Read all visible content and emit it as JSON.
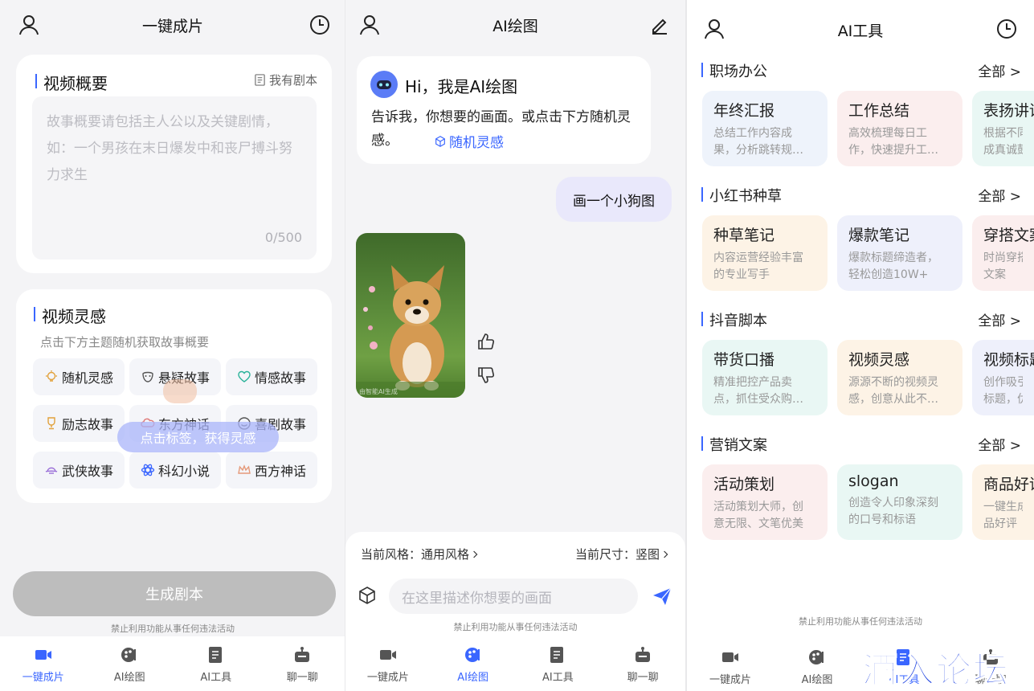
{
  "panel1": {
    "title": "一键成片",
    "summary": {
      "heading": "视频概要",
      "my_script": "我有剧本",
      "placeholder": "故事概要请包括主人公以及关键剧情，如：一个男孩在末日爆发中和丧尸搏斗努力求生",
      "counter": "0/500"
    },
    "inspiration": {
      "heading": "视频灵感",
      "hint": "点击下方主题随机获取故事概要",
      "tags": [
        {
          "label": "随机灵感",
          "icon": "bulb-icon"
        },
        {
          "label": "悬疑故事",
          "icon": "mask-icon"
        },
        {
          "label": "情感故事",
          "icon": "heart-icon"
        },
        {
          "label": "励志故事",
          "icon": "trophy-icon"
        },
        {
          "label": "东方神话",
          "icon": "cloud-icon"
        },
        {
          "label": "喜剧故事",
          "icon": "smile-icon"
        },
        {
          "label": "武侠故事",
          "icon": "hat-icon"
        },
        {
          "label": "科幻小说",
          "icon": "atom-icon"
        },
        {
          "label": "西方神话",
          "icon": "crown-icon"
        }
      ],
      "tooltip": "点击标签，获得灵感"
    },
    "generate_button": "生成剧本",
    "footnote": "禁止利用功能从事任何违法活动"
  },
  "panel2": {
    "title": "AI绘图",
    "greeting_title": "Hi，我是AI绘图",
    "greeting_text": "告诉我，你想要的画面。或点击下方随机灵感。",
    "random_link": "随机灵感",
    "user_message": "画一个小狗图",
    "image_caption": "由智能AI生成",
    "style_label": "当前风格：通用风格",
    "size_label": "当前尺寸：竖图",
    "input_placeholder": "在这里描述你想要的画面",
    "footnote": "禁止利用功能从事任何违法活动"
  },
  "panel3": {
    "title": "AI工具",
    "all_label": "全部",
    "categories": [
      {
        "name": "职场办公",
        "tools": [
          {
            "title": "年终汇报",
            "desc1": "总结工作内容成",
            "desc2": "果，分析跳转规…"
          },
          {
            "title": "工作总结",
            "desc1": "高效梳理每日工",
            "desc2": "作，快速提升工…"
          },
          {
            "title": "表扬讲话",
            "desc1": "根据不同",
            "desc2": "成真诚鼓"
          }
        ]
      },
      {
        "name": "小红书种草",
        "tools": [
          {
            "title": "种草笔记",
            "desc1": "内容运营经验丰富",
            "desc2": "的专业写手"
          },
          {
            "title": "爆款笔记",
            "desc1": "爆款标题缔造者，",
            "desc2": "轻松创造10W+"
          },
          {
            "title": "穿搭文案",
            "desc1": "时尚穿搭",
            "desc2": "文案"
          }
        ]
      },
      {
        "name": "抖音脚本",
        "tools": [
          {
            "title": "带货口播",
            "desc1": "精准把控产品卖",
            "desc2": "点，抓住受众购…"
          },
          {
            "title": "视频灵感",
            "desc1": "源源不断的视频灵",
            "desc2": "感，创意从此不…"
          },
          {
            "title": "视频标题",
            "desc1": "创作吸引",
            "desc2": "标题，优"
          }
        ]
      },
      {
        "name": "营销文案",
        "tools": [
          {
            "title": "活动策划",
            "desc1": "活动策划大师，创",
            "desc2": "意无限、文笔优美"
          },
          {
            "title": "slogan",
            "desc1": "创造令人印象深刻",
            "desc2": "的口号和标语"
          },
          {
            "title": "商品好评",
            "desc1": "一键生成",
            "desc2": "品好评"
          }
        ]
      }
    ],
    "footnote": "禁止利用功能从事任何违法活动"
  },
  "nav": [
    "一键成片",
    "AI绘图",
    "AI工具",
    "聊一聊"
  ],
  "watermark": "酒入论坛",
  "colors": {
    "accent": "#3a66ff",
    "button_disabled": "#bdbdbd",
    "user_bubble": "#e9e8fb"
  }
}
